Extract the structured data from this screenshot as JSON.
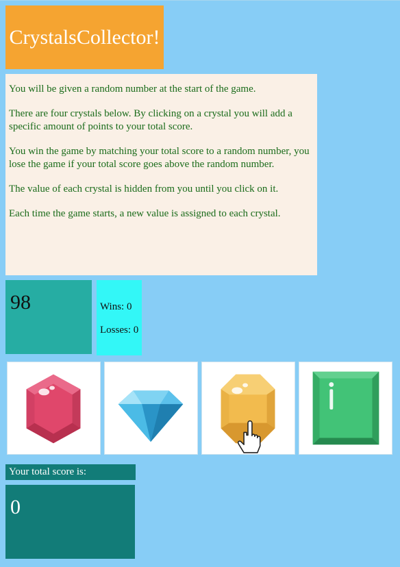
{
  "title": "CrystalsCollector!",
  "instructions": [
    "You will be given a random number at the start of the game.",
    "There are four crystals below. By clicking on a crystal you will add a specific amount of points to your total score.",
    "You win the game by matching your total score to a random number, you lose the game if your total score goes above the random number.",
    "The value of each crystal is hidden from you until you click on it.",
    "Each time the game starts, a new value is assigned to each crystal."
  ],
  "target_number": "98",
  "stats": {
    "wins_label": "Wins: 0",
    "losses_label": "Losses: 0"
  },
  "crystals": [
    {
      "icon": "red-hexagon-gem-icon",
      "color": "#e0476b"
    },
    {
      "icon": "blue-diamond-gem-icon",
      "color": "#3aaee0"
    },
    {
      "icon": "yellow-octagon-gem-icon",
      "color": "#f2bb4e"
    },
    {
      "icon": "green-square-gem-icon",
      "color": "#3fbf72"
    }
  ],
  "score": {
    "label": "Your total score is:",
    "value": "0"
  },
  "colors": {
    "background": "#87cdf6",
    "title_bg": "#f5a431",
    "instructions_bg": "#faf0e6",
    "instructions_text": "#1a6b1a",
    "target_bg": "#26ada3",
    "stats_bg": "#33f7f7",
    "score_bg": "#127c78"
  }
}
